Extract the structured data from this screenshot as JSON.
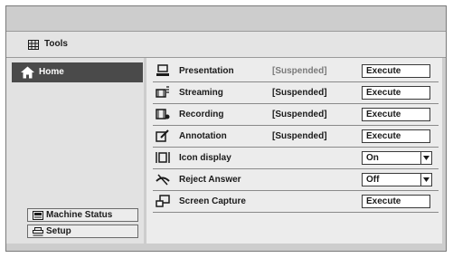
{
  "header": {
    "title": "Tools",
    "icon": "grid-icon"
  },
  "sidebar": {
    "home": {
      "label": "Home",
      "icon": "home-icon"
    },
    "buttons": [
      {
        "label": "Machine Status",
        "icon": "machine-status-icon"
      },
      {
        "label": "Setup",
        "icon": "setup-icon"
      }
    ]
  },
  "rows": [
    {
      "label": "Presentation",
      "status": "[Suspended]",
      "status_muted": true,
      "control": "Execute",
      "icon": "presentation-icon"
    },
    {
      "label": "Streaming",
      "status": "[Suspended]",
      "control": "Execute",
      "icon": "streaming-icon"
    },
    {
      "label": "Recording",
      "status": "[Suspended]",
      "control": "Execute",
      "icon": "recording-icon"
    },
    {
      "label": "Annotation",
      "status": "[Suspended]",
      "control": "Execute",
      "icon": "annotation-icon"
    },
    {
      "label": "Icon display",
      "status": "",
      "control": "On",
      "control_type": "select",
      "icon": "icon-display-icon"
    },
    {
      "label": "Reject Answer",
      "status": "",
      "control": "Off",
      "control_type": "select",
      "icon": "reject-answer-icon"
    },
    {
      "label": "Screen Capture",
      "status": "",
      "control": "Execute",
      "icon": "screen-capture-icon"
    }
  ],
  "colors": {
    "selected": "#4a4a4a",
    "panel": "#ececec",
    "frame": "#cdcdcd"
  }
}
